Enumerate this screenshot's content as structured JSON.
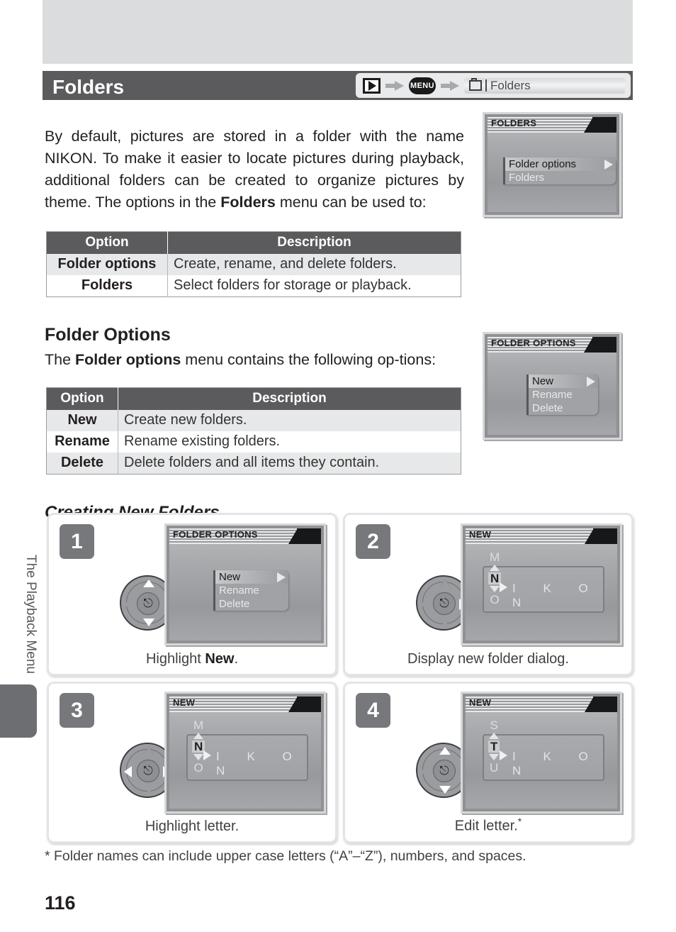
{
  "header": {
    "title": "Folders",
    "nav": {
      "play_icon": "play-icon",
      "menu_label": "MENU",
      "folder_icon": "folder-icon",
      "destination": "Folders"
    }
  },
  "intro_paragraph": "By default, pictures are stored in a folder with the name NIKON.  To make it easier to locate pictures during playback, additional folders can be created to organize pictures by theme.  The options in the Folders menu can be used to:",
  "intro_paragraph_parts": {
    "a": "By default, pictures are stored in a folder with the name NIKON.  To make it easier to locate pictures during playback, additional folders can be created to organize pictures by theme.  The options in the ",
    "bold": "Folders",
    "b": " menu can be used to:"
  },
  "table_folders": {
    "headers": [
      "Option",
      "Description"
    ],
    "rows": [
      {
        "option": "Folder options",
        "description": "Create, rename, and delete folders."
      },
      {
        "option": "Folders",
        "description": "Select folders for storage or playback."
      }
    ]
  },
  "folder_options_section": {
    "heading": "Folder Options",
    "intro_a": "The ",
    "intro_bold": "Folder options",
    "intro_b": " menu contains the following op-tions:"
  },
  "table_folder_options": {
    "headers": [
      "Option",
      "Description"
    ],
    "rows": [
      {
        "option": "New",
        "description": "Create new folders."
      },
      {
        "option": "Rename",
        "description": "Rename existing folders."
      },
      {
        "option": "Delete",
        "description": "Delete folders and all items they contain."
      }
    ]
  },
  "creating_heading": "Creating New Folders",
  "lcd_folders": {
    "title": "FOLDERS",
    "items": [
      {
        "label": "Folder options",
        "selected": true,
        "arrow": true
      },
      {
        "label": "Folders",
        "selected": false,
        "arrow": false
      }
    ]
  },
  "lcd_folder_options": {
    "title": "FOLDER OPTIONS",
    "items": [
      {
        "label": "New",
        "selected": true,
        "arrow": true
      },
      {
        "label": "Rename",
        "selected": false,
        "arrow": false
      },
      {
        "label": "Delete",
        "selected": false,
        "arrow": false
      }
    ]
  },
  "steps": [
    {
      "number": "1",
      "caption_a": "Highlight ",
      "caption_bold": "New",
      "caption_b": ".",
      "dpad": {
        "up": true,
        "down": true,
        "left": false,
        "right": false,
        "center_icon": "enter-icon"
      },
      "screen": {
        "kind": "menu",
        "title": "FOLDER OPTIONS",
        "items": [
          {
            "label": "New",
            "selected": true,
            "arrow": true
          },
          {
            "label": "Rename",
            "selected": false,
            "arrow": false
          },
          {
            "label": "Delete",
            "selected": false,
            "arrow": false
          }
        ]
      }
    },
    {
      "number": "2",
      "caption_a": "Display new folder dialog.",
      "caption_bold": "",
      "caption_b": "",
      "dpad": {
        "up": false,
        "down": false,
        "left": false,
        "right": true,
        "center_icon": "enter-icon"
      },
      "screen": {
        "kind": "name",
        "title": "NEW",
        "letter_above": "M",
        "letter_current": "N",
        "letter_below": "O",
        "rest": "I K O N"
      }
    },
    {
      "number": "3",
      "caption_a": "Highlight letter.",
      "caption_bold": "",
      "caption_b": "",
      "dpad": {
        "up": false,
        "down": false,
        "left": true,
        "right": true,
        "center_icon": "enter-icon"
      },
      "screen": {
        "kind": "name",
        "title": "NEW",
        "letter_above": "M",
        "letter_current": "N",
        "letter_below": "O",
        "rest": "I K O N"
      }
    },
    {
      "number": "4",
      "caption_a": "Edit letter.",
      "caption_bold": "",
      "caption_b": "*",
      "dpad": {
        "up": true,
        "down": true,
        "left": false,
        "right": false,
        "center_icon": "enter-icon"
      },
      "screen": {
        "kind": "name",
        "title": "NEW",
        "letter_above": "S",
        "letter_current": "T",
        "letter_below": "U",
        "rest": "I K O N"
      }
    }
  ],
  "footnote": "* Folder names can include upper case letters (“A”–“Z”), numbers, and spaces.",
  "side_tab_label": "The Playback Menu",
  "page_number": "116",
  "colors": {
    "title_bar": "#5b5b5d",
    "top_band": "#dbdcde",
    "table_header": "#5b5b5d",
    "row_alt": "#e7e8ea",
    "step_badge": "#77787b",
    "side_tab": "#6d6e71"
  }
}
